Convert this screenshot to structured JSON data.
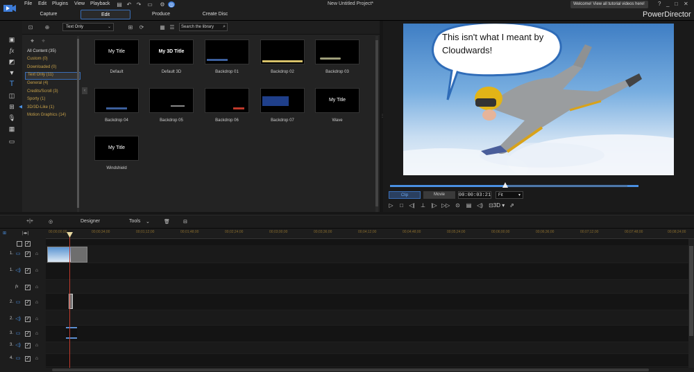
{
  "menu": {
    "items": [
      "File",
      "Edit",
      "Plugins",
      "View",
      "Playback"
    ],
    "project_title": "New Untitled Project*",
    "welcome": "Welcome! View all tutorial videos here!",
    "brand": "PowerDirector",
    "window_controls": [
      "?",
      "_",
      "□",
      "✕"
    ]
  },
  "main_tabs": [
    "Capture",
    "Edit",
    "Produce",
    "Create Disc"
  ],
  "library": {
    "filter": "Text Only",
    "search_placeholder": "Search the library",
    "categories": [
      "All Content  (35)",
      "Custom  (0)",
      "Downloaded  (0)",
      "Text Only  (11)",
      "General  (4)",
      "Credits/Scroll  (3)",
      "Sporty  (1)",
      "3D/3D-Like  (1)",
      "Motion Graphics  (14)"
    ],
    "templates": [
      {
        "label": "Default",
        "thumb_text": "My Title"
      },
      {
        "label": "Default 3D",
        "thumb_text": "My 3D Title"
      },
      {
        "label": "Backdrop 01",
        "thumb_text": ""
      },
      {
        "label": "Backdrop 02",
        "thumb_text": ""
      },
      {
        "label": "Backdrop 03",
        "thumb_text": ""
      },
      {
        "label": "Backdrop 04",
        "thumb_text": ""
      },
      {
        "label": "Backdrop 05",
        "thumb_text": ""
      },
      {
        "label": "Backdrop 06",
        "thumb_text": ""
      },
      {
        "label": "Backdrop 07",
        "thumb_text": ""
      },
      {
        "label": "Wave",
        "thumb_text": "My Title"
      },
      {
        "label": "Windshield",
        "thumb_text": "My Title"
      }
    ]
  },
  "preview": {
    "speech_text": "This isn't what I meant by Cloudwards!",
    "mode_tabs": [
      "Clip",
      "Movie"
    ],
    "active_mode": "Clip",
    "timecode": "00:00:03:21",
    "zoom": "Fit",
    "playback_progress": 0.48,
    "stereo": "3D ▾"
  },
  "timeline_tools": {
    "designer": "Designer",
    "tools": "Tools"
  },
  "ruler_ticks": [
    "00;00;00;00",
    "00;00;34;00",
    "00;01;12;00",
    "00;01;48;00",
    "00;02;24;00",
    "00;03;00;00",
    "00;03;36;00",
    "00;04;12;00",
    "00;04;48;00",
    "00;05;24;00",
    "00;06;00;00",
    "00;06;36;00",
    "00;07;12;00",
    "00;07;48;00",
    "00;08;24;00"
  ],
  "tracks": [
    {
      "num": "",
      "icon": "",
      "type": "header"
    },
    {
      "num": "1.",
      "icon": "video-track-icon",
      "type": "video"
    },
    {
      "num": "1.",
      "icon": "audio-track-icon",
      "type": "audio"
    },
    {
      "num": "fx",
      "icon": "",
      "type": "fx"
    },
    {
      "num": "2.",
      "icon": "video-track-icon",
      "type": "video"
    },
    {
      "num": "2.",
      "icon": "audio-track-icon",
      "type": "audio"
    },
    {
      "num": "3.",
      "icon": "video-track-icon",
      "type": "video"
    },
    {
      "num": "3.",
      "icon": "audio-track-icon",
      "type": "audio"
    },
    {
      "num": "4.",
      "icon": "video-track-icon",
      "type": "video"
    }
  ]
}
